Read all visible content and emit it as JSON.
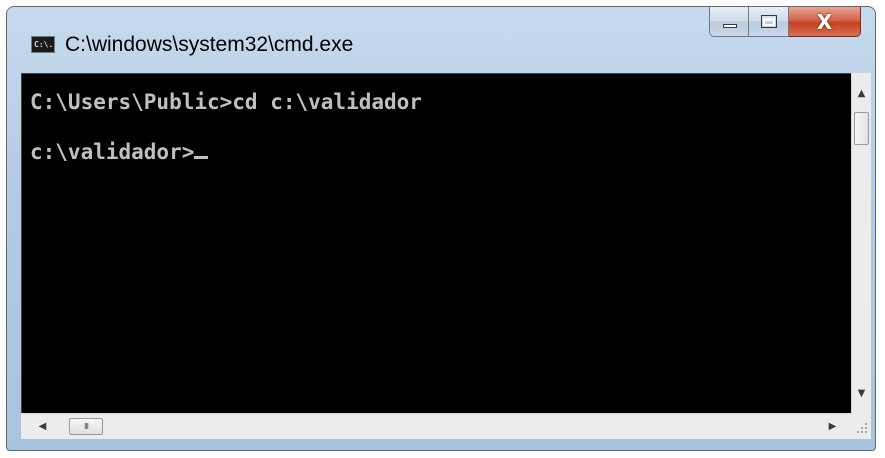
{
  "window": {
    "title": "C:\\windows\\system32\\cmd.exe",
    "icon": "cmd-icon",
    "icon_text": "C:\\.",
    "controls": {
      "minimize_icon": "minimize-icon",
      "maximize_icon": "maximize-icon",
      "close_icon": "close-icon",
      "close_glyph": "X"
    }
  },
  "console": {
    "background": "#000000",
    "text_color": "#c0c0c0",
    "lines": [
      "C:\\Users\\Public>cd c:\\validador",
      "c:\\validador>"
    ]
  },
  "scrollbars": {
    "vertical": {
      "up_glyph": "▲",
      "down_glyph": "▼"
    },
    "horizontal": {
      "left_glyph": "◀",
      "right_glyph": "▶",
      "thumb_grip": "III"
    }
  },
  "colors": {
    "frame": "#b3cbe3",
    "close_button": "#c5411f"
  }
}
